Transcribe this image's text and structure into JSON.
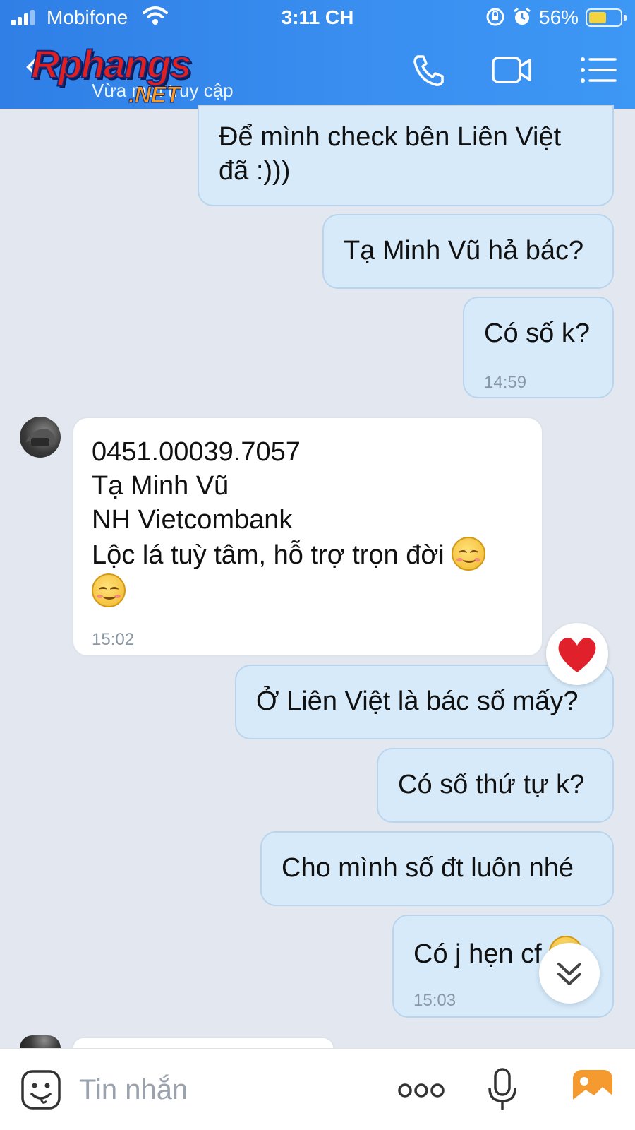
{
  "status_bar": {
    "carrier": "Mobifone",
    "time": "3:11 CH",
    "battery": "56%",
    "battery_level": 0.56,
    "icons": [
      "signal-icon",
      "wifi-icon",
      "orientation-lock-icon",
      "alarm-icon",
      "battery-icon"
    ]
  },
  "header": {
    "logo_main": "Rphangs",
    "logo_suffix": ".NET",
    "subtitle": "Vừa mới truy cập",
    "icons": [
      "back-icon",
      "phone-icon",
      "video-call-icon",
      "menu-icon"
    ]
  },
  "messages": [
    {
      "from": "me",
      "lines": [
        "Để mình check bên Liên Việt",
        "đã :)))"
      ]
    },
    {
      "from": "me",
      "lines": [
        "Tạ Minh Vũ hả bác?"
      ]
    },
    {
      "from": "me",
      "lines": [
        "Có số k?"
      ],
      "time": "14:59"
    },
    {
      "from": "them",
      "lines": [
        "0451.00039.7057",
        "Tạ Minh Vũ",
        "NH Vietcombank",
        "Lộc lá tuỳ tâm, hỗ trợ trọn đời"
      ],
      "time": "15:02",
      "emoji": "blushing-smile"
    },
    {
      "from": "me",
      "lines": [
        "Ở Liên Việt là bác số mấy?"
      ]
    },
    {
      "from": "me",
      "lines": [
        "Có số thứ tự k?"
      ]
    },
    {
      "from": "me",
      "lines": [
        "Cho mình số đt luôn nhé"
      ]
    },
    {
      "from": "me",
      "lines": [
        "Có j hẹn cf"
      ],
      "time": "15:03"
    }
  ],
  "reaction": {
    "icon": "heart-icon",
    "color": "#e0202a"
  },
  "composer": {
    "placeholder": "Tin nhắn",
    "icons": [
      "sticker-icon",
      "more-icon",
      "microphone-icon",
      "photo-icon"
    ]
  },
  "colors": {
    "header": "#3a8ff0",
    "outgoing_bubble": "#d6eafa",
    "incoming_bubble": "#ffffff",
    "background": "#e3e8f0",
    "photo_icon": "#f59a2f"
  }
}
